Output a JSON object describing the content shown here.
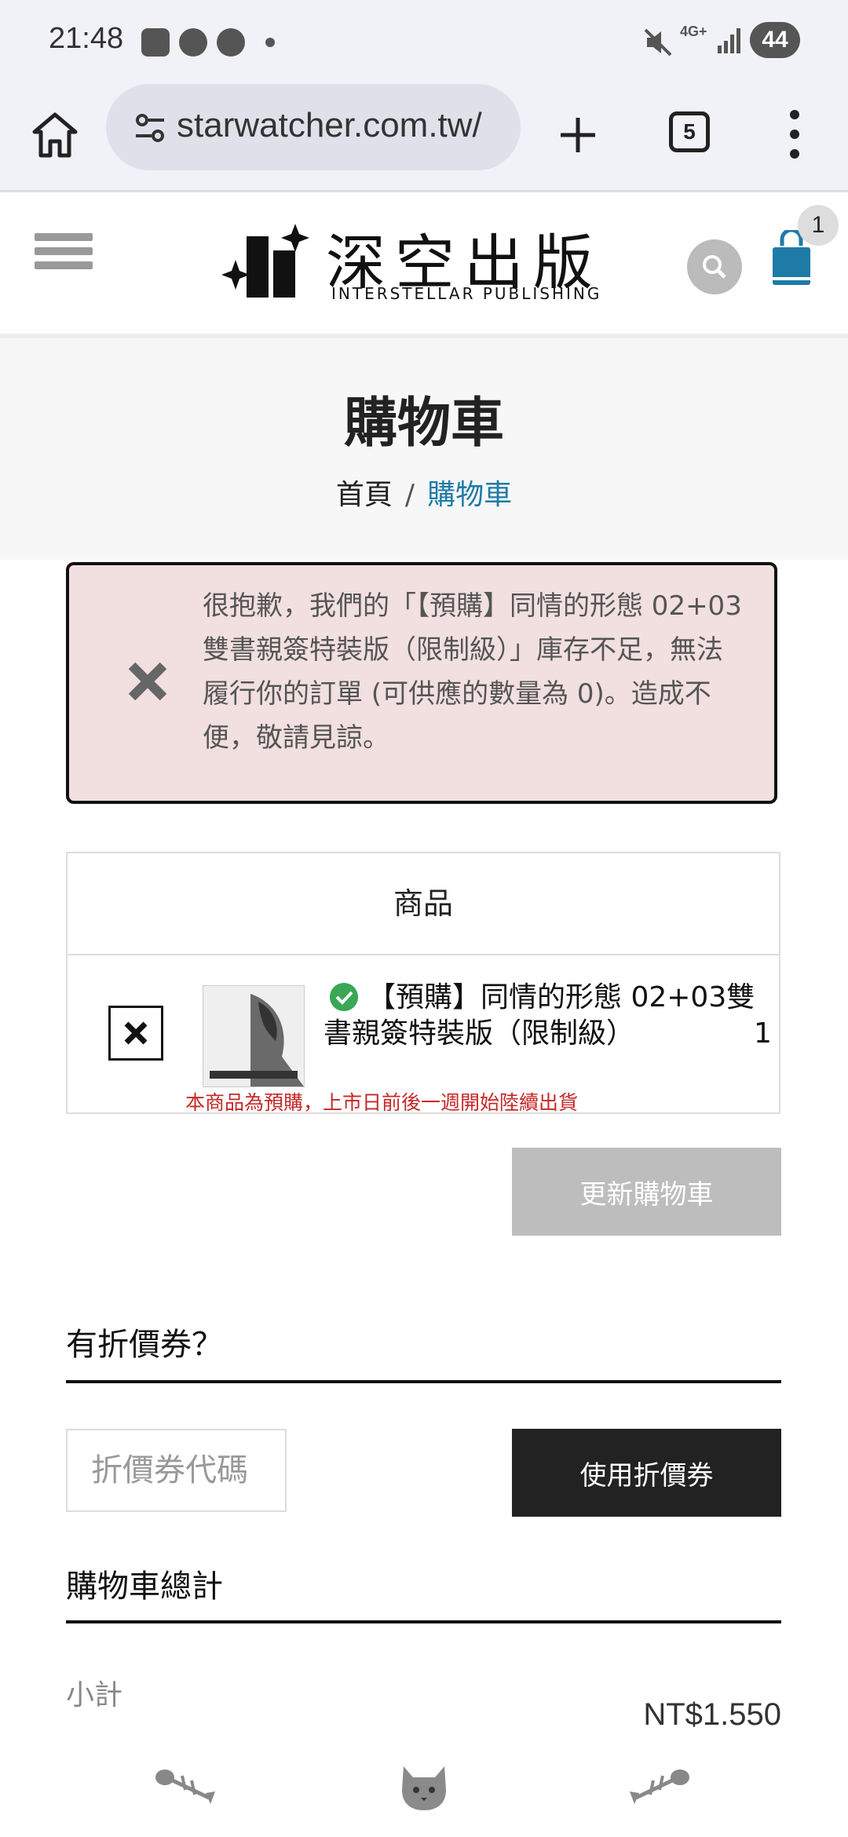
{
  "status_bar": {
    "time": "21:48",
    "battery": "44",
    "network": "4G+"
  },
  "browser": {
    "url": "starwatcher.com.tw/",
    "tab_count": "5"
  },
  "site": {
    "logo_cjk": "深空出版",
    "logo_en": "INTERSTELLAR PUBLISHING",
    "cart_count": "1"
  },
  "page": {
    "title": "購物車",
    "breadcrumb_home": "首頁",
    "breadcrumb_sep": "/",
    "breadcrumb_current": "購物車"
  },
  "notice": {
    "text": "很抱歉，我們的「【預購】同情的形態 02+03雙書親簽特裝版（限制級）」庫存不足，無法履行你的訂單 (可供應的數量為 0)。造成不便，敬請見諒。"
  },
  "cart_table": {
    "header": "商品",
    "items": [
      {
        "name": "【預購】同情的形態 02+03雙書親簽特裝版（限制級）",
        "quantity": "1",
        "note": "本商品為預購，上市日前後一週開始陸續出貨"
      }
    ],
    "update_button": "更新購物車"
  },
  "coupon": {
    "heading": "有折價券？",
    "placeholder": "折價券代碼",
    "apply_button": "使用折價券"
  },
  "totals": {
    "heading": "購物車總計",
    "subtotal_label": "小計",
    "subtotal_value": "NT$1.550"
  },
  "colors": {
    "accent_link": "#1e7ba6",
    "notice_bg": "#f2dfe0",
    "preorder_red": "#c62828",
    "in_stock_green": "#3aa757"
  }
}
